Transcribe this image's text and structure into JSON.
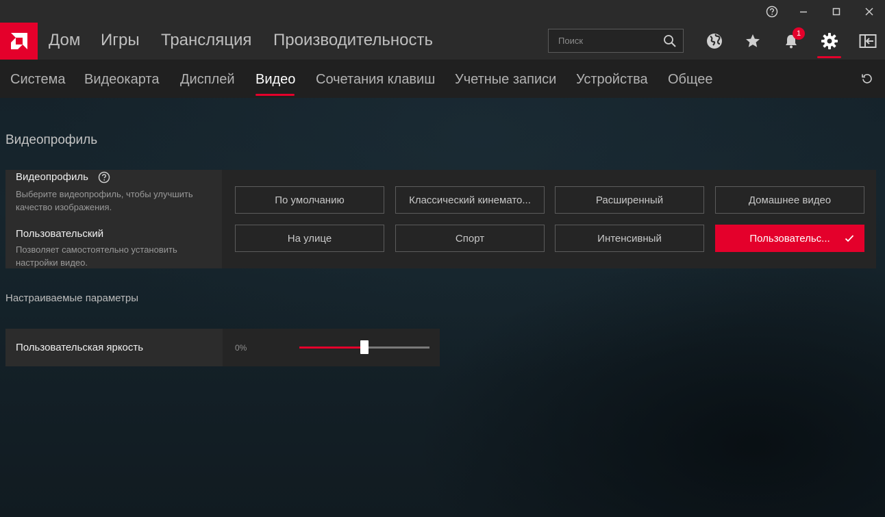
{
  "window": {
    "help_icon": "help-circle-icon",
    "minimize_icon": "minimize-icon",
    "maximize_icon": "maximize-icon",
    "close_icon": "close-icon"
  },
  "nav": {
    "items": [
      "Дом",
      "Игры",
      "Трансляция",
      "Производительность"
    ],
    "search_placeholder": "Поиск",
    "notification_count": "1"
  },
  "subnav": {
    "items": [
      "Система",
      "Видеокарта",
      "Дисплей",
      "Видео",
      "Сочетания клавиш",
      "Учетные записи",
      "Устройства",
      "Общее"
    ],
    "active": "Видео"
  },
  "video_profile": {
    "section_title": "Видеопрофиль",
    "label": "Видеопрофиль",
    "description": "Выберите видеопрофиль, чтобы улучшить качество изображения.",
    "current_label": "Пользовательский",
    "current_description": "Позволяет самостоятельно установить настройки видео.",
    "options": [
      {
        "label": "По умолчанию",
        "selected": false
      },
      {
        "label": "Классический кинемато...",
        "selected": false
      },
      {
        "label": "Расширенный",
        "selected": false
      },
      {
        "label": "Домашнее видео",
        "selected": false
      },
      {
        "label": "На улице",
        "selected": false
      },
      {
        "label": "Спорт",
        "selected": false
      },
      {
        "label": "Интенсивный",
        "selected": false
      },
      {
        "label": "Пользовательс...",
        "selected": true
      }
    ]
  },
  "custom_params": {
    "title": "Настраиваемые параметры",
    "brightness_label": "Пользовательская яркость",
    "brightness_value_text": "0%",
    "brightness_slider_fraction": 0.5
  },
  "colors": {
    "accent": "#e4002b",
    "nav_bg": "#2b2b2b",
    "subnav_bg": "#202020"
  }
}
